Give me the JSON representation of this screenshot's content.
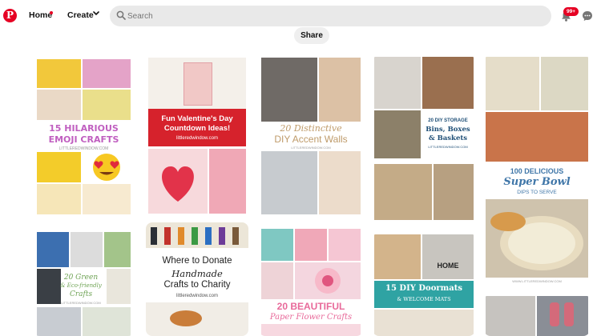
{
  "app": {
    "name": "Pinterest",
    "logo_letter": "P"
  },
  "header": {
    "nav": {
      "home": "Home",
      "create": "Create"
    },
    "search": {
      "placeholder": "Search"
    },
    "notifications_badge": "99+",
    "icons": [
      "pinterest-logo-icon",
      "chevron-down-icon",
      "search-icon",
      "bell-icon",
      "chat-icon"
    ]
  },
  "board": {
    "share_label": "Share"
  },
  "pins": {
    "emoji": {
      "title": "15 HILARIOUS EMOJI CRAFTS",
      "line1": "15 HILARIOUS",
      "line2": "EMOJI CRAFTS",
      "site": "LITTLEREDWINDOW.COM"
    },
    "valentine": {
      "line1": "Fun Valentine's Day",
      "line2": "Countdown Ideas!",
      "site": "littleredwindow.com"
    },
    "accent": {
      "line1": "20 Distinctive",
      "line2": "DIY Accent Walls",
      "site": "LITTLEREDWINDOW.COM"
    },
    "storage": {
      "line1": "20 DIY STORAGE",
      "line2": "Bins, Boxes",
      "line3": "& Baskets",
      "site": "LITTLEREDWINDOW.COM"
    },
    "superbowl": {
      "line1": "100 DELICIOUS",
      "line2": "Super Bowl",
      "line3": "DIPS TO SERVE",
      "site": "WWW.LITTLEREDWINDOW.COM"
    },
    "green": {
      "line1": "20 Green",
      "line2": "& Eco-friendly",
      "line3": "Crafts",
      "site": "LITTLEREDWINDOW.COM"
    },
    "donate": {
      "line1": "Where to Donate",
      "line2": "Handmade",
      "line3": "Crafts to Charity",
      "site": "littleredwindow.com"
    },
    "flower": {
      "line1": "20 BEAUTIFUL",
      "line2": "Paper Flower Crafts"
    },
    "doormats": {
      "line1": "15 DIY Doormats",
      "line2": "& WELCOME MATS",
      "mat_text": "HOME"
    }
  },
  "colors": {
    "brand": "#e60023",
    "search_bg": "#e9e9e9",
    "emoji_title": "#c05fc0",
    "valentine_band": "#d6222c",
    "accent_title": "#bf9b6a",
    "storage_title": "#1f4f77",
    "superbowl_title": "#3f76a8",
    "green_title": "#6ea354",
    "flower_title": "#e86a9a",
    "doormat_band": "#2fa3a3"
  }
}
